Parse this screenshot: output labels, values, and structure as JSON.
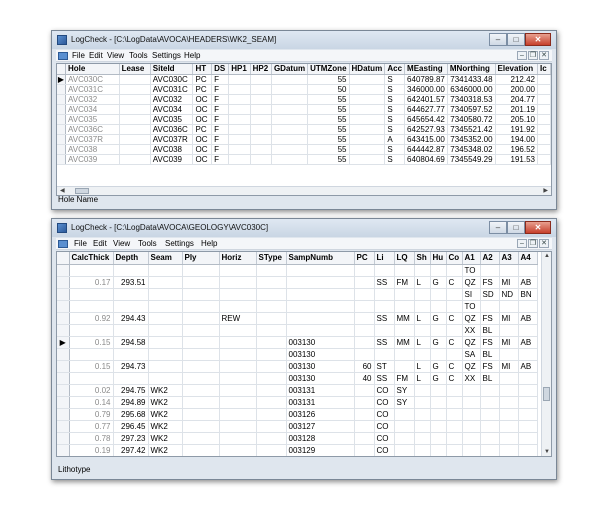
{
  "window1": {
    "title": "LogCheck - [C:\\LogData\\AVOCA\\HEADERS\\WK2_SEAM]",
    "menu": [
      "File",
      "Edit",
      "View",
      "Tools",
      "Settings",
      "Help"
    ],
    "columns": [
      "Hole",
      "Lease",
      "SiteId",
      "HT",
      "DS",
      "HP1",
      "HP2",
      "GDatum",
      "UTMZone",
      "HDatum",
      "Acc",
      "MEasting",
      "MNorthing",
      "Elevation",
      "Ic"
    ],
    "rows": [
      [
        "AVC030C",
        "",
        "AVC030C",
        "PC",
        "F",
        "",
        "",
        "",
        "55",
        "",
        "S",
        "640789.87",
        "7341433.48",
        "212.42",
        ""
      ],
      [
        "AVC031C",
        "",
        "AVC031C",
        "PC",
        "F",
        "",
        "",
        "",
        "50",
        "",
        "S",
        "346000.00",
        "6346000.00",
        "200.00",
        ""
      ],
      [
        "AVC032",
        "",
        "AVC032",
        "OC",
        "F",
        "",
        "",
        "",
        "55",
        "",
        "S",
        "642401.57",
        "7340318.53",
        "204.77",
        ""
      ],
      [
        "AVC034",
        "",
        "AVC034",
        "OC",
        "F",
        "",
        "",
        "",
        "55",
        "",
        "S",
        "644627.77",
        "7340597.52",
        "201.19",
        ""
      ],
      [
        "AVC035",
        "",
        "AVC035",
        "OC",
        "F",
        "",
        "",
        "",
        "55",
        "",
        "S",
        "645654.42",
        "7340580.72",
        "205.10",
        ""
      ],
      [
        "AVC036C",
        "",
        "AVC036C",
        "PC",
        "F",
        "",
        "",
        "",
        "55",
        "",
        "S",
        "642527.93",
        "7345521.42",
        "191.92",
        ""
      ],
      [
        "AVC037R",
        "",
        "AVC037R",
        "OC",
        "F",
        "",
        "",
        "",
        "55",
        "",
        "A",
        "643415.00",
        "7345352.00",
        "194.00",
        ""
      ],
      [
        "AVC038",
        "",
        "AVC038",
        "OC",
        "F",
        "",
        "",
        "",
        "55",
        "",
        "S",
        "644442.87",
        "7345348.02",
        "196.52",
        ""
      ],
      [
        "AVC039",
        "",
        "AVC039",
        "OC",
        "F",
        "",
        "",
        "",
        "55",
        "",
        "S",
        "640804.69",
        "7345549.29",
        "191.53",
        ""
      ]
    ],
    "status": "Hole Name"
  },
  "window2": {
    "title": "LogCheck - [C:\\LogData\\AVOCA\\GEOLOGY\\AVC030C]",
    "menu": [
      "File",
      "Edit",
      "View",
      "Tools",
      "Settings",
      "Help"
    ],
    "columns": [
      "CalcThick",
      "Depth",
      "Seam",
      "Ply",
      "Horiz",
      "SType",
      "SampNumb",
      "PC",
      "Li",
      "LQ",
      "Sh",
      "Hu",
      "Co",
      "A1",
      "A2",
      "A3",
      "A4"
    ],
    "rows": [
      [
        "",
        "",
        "",
        "",
        "",
        "",
        "",
        "",
        "",
        "",
        "",
        "",
        "",
        "TO",
        "",
        "",
        ""
      ],
      [
        "0.17",
        "293.51",
        "",
        "",
        "",
        "",
        "",
        "",
        "SS",
        "FM",
        "L",
        "G",
        "C",
        "QZ",
        "FS",
        "MI",
        "AB"
      ],
      [
        "",
        "",
        "",
        "",
        "",
        "",
        "",
        "",
        "",
        "",
        "",
        "",
        "",
        "SI",
        "SD",
        "ND",
        "BN"
      ],
      [
        "",
        "",
        "",
        "",
        "",
        "",
        "",
        "",
        "",
        "",
        "",
        "",
        "",
        "TO",
        "",
        "",
        ""
      ],
      [
        "0.92",
        "294.43",
        "",
        "",
        "REW",
        "",
        "",
        "",
        "SS",
        "MM",
        "L",
        "G",
        "C",
        "QZ",
        "FS",
        "MI",
        "AB"
      ],
      [
        "",
        "",
        "",
        "",
        "",
        "",
        "",
        "",
        "",
        "",
        "",
        "",
        "",
        "XX",
        "BL",
        "",
        ""
      ],
      [
        "0.15",
        "294.58",
        "",
        "",
        "",
        "",
        "003130",
        "",
        "SS",
        "MM",
        "L",
        "G",
        "C",
        "QZ",
        "FS",
        "MI",
        "AB"
      ],
      [
        "",
        "",
        "",
        "",
        "",
        "",
        "003130",
        "",
        "",
        "",
        "",
        "",
        "",
        "SA",
        "BL",
        "",
        ""
      ],
      [
        "0.15",
        "294.73",
        "",
        "",
        "",
        "",
        "003130",
        "60",
        "ST",
        "",
        "L",
        "G",
        "C",
        "QZ",
        "FS",
        "MI",
        "AB"
      ],
      [
        "",
        "",
        "",
        "",
        "",
        "",
        "003130",
        "40",
        "SS",
        "FM",
        "L",
        "G",
        "C",
        "XX",
        "BL",
        "",
        ""
      ],
      [
        "0.02",
        "294.75",
        "WK2",
        "",
        "",
        "",
        "003131",
        "",
        "CO",
        "SY",
        "",
        "",
        "",
        "",
        "",
        "",
        ""
      ],
      [
        "0.14",
        "294.89",
        "WK2",
        "",
        "",
        "",
        "003131",
        "",
        "CO",
        "SY",
        "",
        "",
        "",
        "",
        "",
        "",
        ""
      ],
      [
        "0.79",
        "295.68",
        "WK2",
        "",
        "",
        "",
        "003126",
        "",
        "CO",
        "",
        "",
        "",
        "",
        "",
        "",
        "",
        ""
      ],
      [
        "0.77",
        "296.45",
        "WK2",
        "",
        "",
        "",
        "003127",
        "",
        "CO",
        "",
        "",
        "",
        "",
        "",
        "",
        "",
        ""
      ],
      [
        "0.78",
        "297.23",
        "WK2",
        "",
        "",
        "",
        "003128",
        "",
        "CO",
        "",
        "",
        "",
        "",
        "",
        "",
        "",
        ""
      ],
      [
        "0.19",
        "297.42",
        "WK2",
        "",
        "",
        "",
        "003129",
        "",
        "CO",
        "",
        "",
        "",
        "",
        "",
        "",
        "",
        ""
      ]
    ],
    "status": "Lithotype"
  }
}
